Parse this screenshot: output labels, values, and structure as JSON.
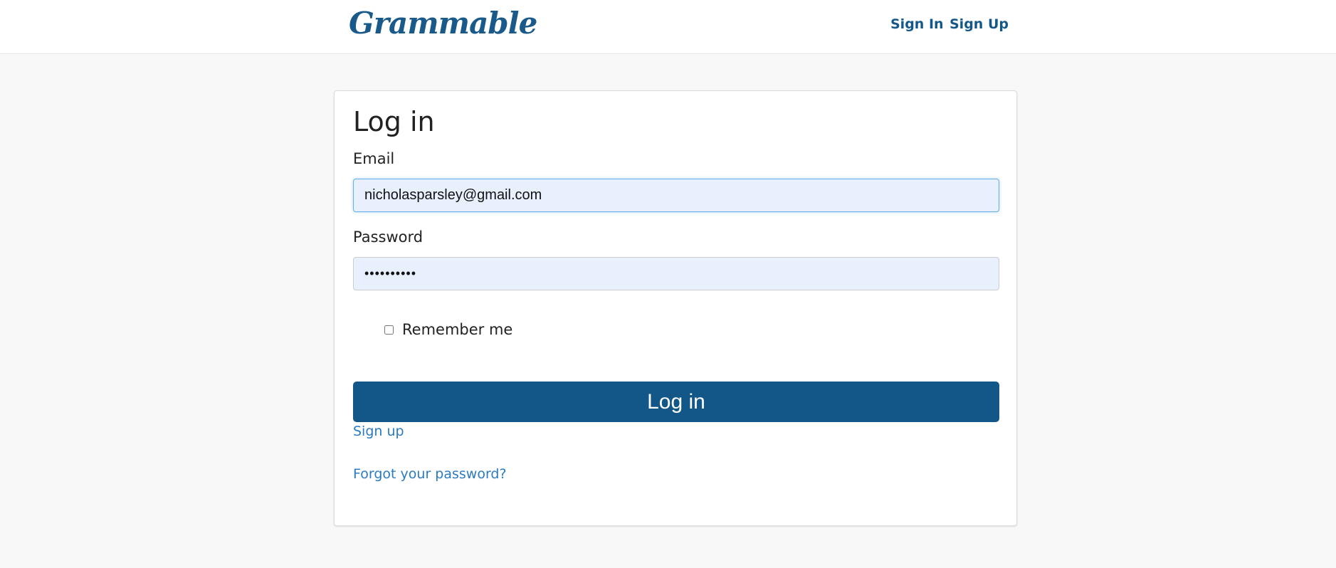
{
  "header": {
    "brand": "Grammable",
    "nav": {
      "sign_in": "Sign In",
      "sign_up": "Sign Up"
    }
  },
  "form": {
    "title": "Log in",
    "email": {
      "label": "Email",
      "value": "nicholasparsley@gmail.com"
    },
    "password": {
      "label": "Password",
      "value": "••••••••••"
    },
    "remember": {
      "label": "Remember me",
      "checked": false
    },
    "submit_label": "Log in",
    "links": {
      "sign_up": "Sign up",
      "forgot_password": "Forgot your password?"
    }
  },
  "colors": {
    "brand": "#1a5a8a",
    "primary_button": "#135788",
    "link": "#2a7bc0",
    "autofill_background": "#e8f0fe",
    "page_background": "#f8f8f8"
  }
}
